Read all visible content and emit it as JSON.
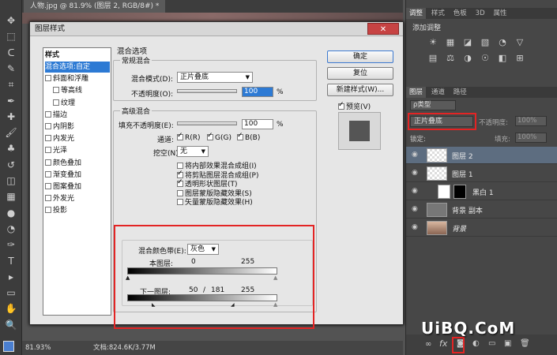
{
  "document": {
    "tab_title": "人物.jpg @ 81.9% (图层 2, RGB/8#) *",
    "zoom": "81.93%",
    "doc_info": "文档:824.6K/3.77M"
  },
  "tools": [
    "move-icon",
    "marquee-icon",
    "lasso-icon",
    "quick-select-icon",
    "crop-icon",
    "eyedropper-icon",
    "healing-icon",
    "brush-icon",
    "stamp-icon",
    "history-brush-icon",
    "eraser-icon",
    "gradient-icon",
    "blur-icon",
    "dodge-icon",
    "pen-icon",
    "type-icon",
    "path-select-icon",
    "shape-icon",
    "hand-icon",
    "zoom-icon"
  ],
  "right_panel": {
    "top_tabs": [
      "调整",
      "样式",
      "色板",
      "3D",
      "属性"
    ],
    "adjust_label": "添加调整",
    "layer_tabs": [
      "图层",
      "通道",
      "路径"
    ],
    "filter_kind": "ρ类型",
    "blend_mode": "正片叠底",
    "opacity_label": "不透明度:",
    "opacity_value": "100%",
    "lock_label": "锁定:",
    "fill_label": "填充:",
    "fill_value": "100%",
    "layers": [
      {
        "name": "图层 2"
      },
      {
        "name": "图层 1"
      },
      {
        "name": "黑白 1"
      },
      {
        "name": "背景 副本"
      },
      {
        "name": "背景"
      }
    ]
  },
  "dialog": {
    "title": "图层样式",
    "close_glyph": "✕",
    "styles_header": "样式",
    "styles": [
      {
        "label": "混合选项:自定",
        "checkbox": false,
        "selected": true
      },
      {
        "label": "斜面和浮雕",
        "checkbox": true
      },
      {
        "label": "等高线",
        "checkbox": true,
        "indent": true
      },
      {
        "label": "纹理",
        "checkbox": true,
        "indent": true
      },
      {
        "label": "描边",
        "checkbox": true
      },
      {
        "label": "内阴影",
        "checkbox": true
      },
      {
        "label": "内发光",
        "checkbox": true
      },
      {
        "label": "光泽",
        "checkbox": true
      },
      {
        "label": "颜色叠加",
        "checkbox": true
      },
      {
        "label": "渐变叠加",
        "checkbox": true
      },
      {
        "label": "图案叠加",
        "checkbox": true
      },
      {
        "label": "外发光",
        "checkbox": true
      },
      {
        "label": "投影",
        "checkbox": true
      }
    ],
    "blend_options_title": "混合选项",
    "general_title": "常规混合",
    "blend_mode_label": "混合模式(D):",
    "blend_mode_value": "正片叠底",
    "opacity_label": "不透明度(O):",
    "opacity_value": "100",
    "percent": "%",
    "advanced_title": "高级混合",
    "fill_opacity_label": "填充不透明度(E):",
    "fill_opacity_value": "100",
    "channels_label": "通道:",
    "channels": [
      {
        "label": "R(R)",
        "checked": true
      },
      {
        "label": "G(G)",
        "checked": true
      },
      {
        "label": "B(B)",
        "checked": true
      }
    ],
    "knockout_label": "挖空(N):",
    "knockout_value": "无",
    "advanced_options": [
      {
        "label": "将内部效果混合成组(I)",
        "checked": false
      },
      {
        "label": "将剪贴图层混合成组(P)",
        "checked": true
      },
      {
        "label": "透明形状图层(T)",
        "checked": true
      },
      {
        "label": "图层蒙版隐藏效果(S)",
        "checked": false
      },
      {
        "label": "矢量蒙版隐藏效果(H)",
        "checked": false
      }
    ],
    "blend_if_label": "混合颜色带(E):",
    "blend_if_value": "灰色",
    "this_layer_label": "本图层:",
    "this_layer_low": "0",
    "this_layer_high": "255",
    "underlying_label": "下一图层:",
    "underlying_low": "50",
    "underlying_sep": "/",
    "underlying_mid": "181",
    "underlying_high": "255",
    "buttons": {
      "ok": "确定",
      "reset": "复位",
      "new_style": "新建样式(W)...",
      "preview": "预览(V)"
    },
    "preview_checked": true
  },
  "watermark": "UiBQ.CoM",
  "colors": {
    "highlight": "#e32424",
    "selection": "#2d7ad4"
  }
}
